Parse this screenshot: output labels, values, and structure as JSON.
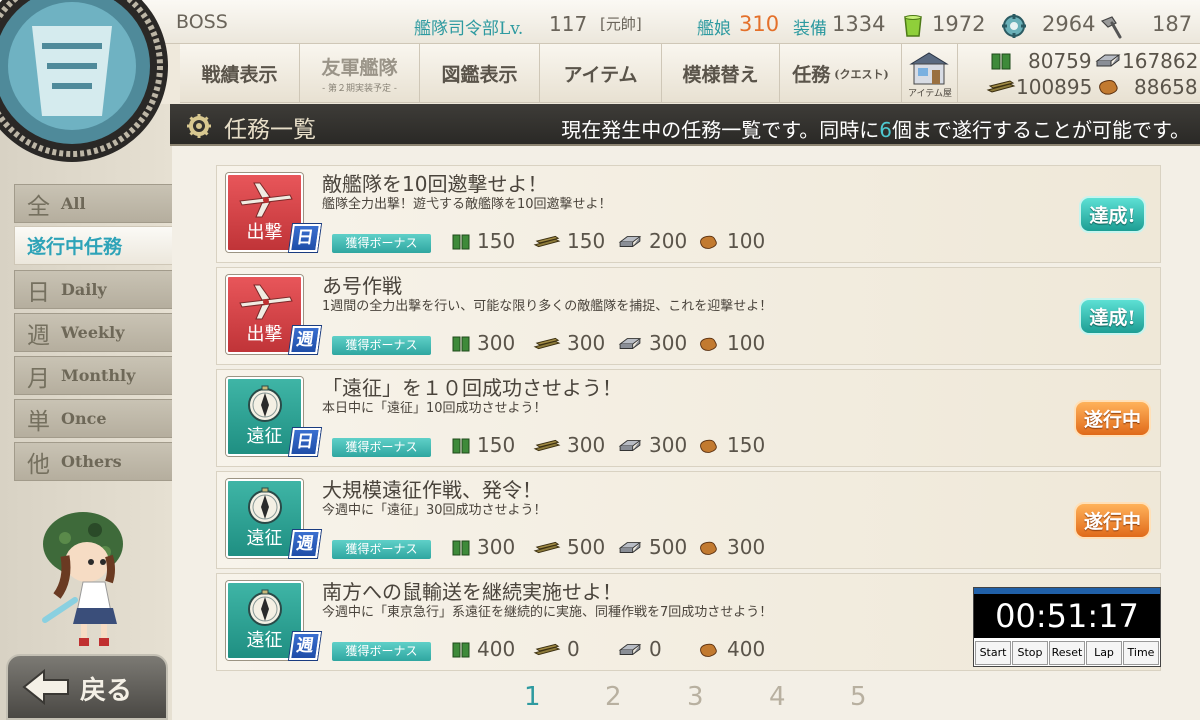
{
  "header": {
    "player_name": "BOSS",
    "hq_label": "艦隊司令部Lv.",
    "hq_level": "117",
    "rank": "[元帥]",
    "ships_label": "艦娘",
    "ships_count": "310",
    "equip_label": "装備",
    "equip_count": "1334",
    "buckets": "1972",
    "dev_materials": "2964",
    "screws": "187"
  },
  "nav": {
    "tabs": [
      {
        "label": "戦績表示"
      },
      {
        "label": "友軍艦隊",
        "sub": "- 第２期実装予定 -"
      },
      {
        "label": "図鑑表示"
      },
      {
        "label": "アイテム"
      },
      {
        "label": "模様替え"
      },
      {
        "label": "任務",
        "small": "(クエスト)"
      }
    ],
    "shop_label": "アイテム屋"
  },
  "resources": {
    "fuel": "80759",
    "steel": "167862",
    "ammo": "100895",
    "bauxite": "88658"
  },
  "title_bar": {
    "title": "任務一覧",
    "info_pre": "現在発生中の任務一覧です。同時に",
    "info_num": "6",
    "info_post": "個まで遂行することが可能です。"
  },
  "sidebar": {
    "tabs": [
      {
        "kanji": "全",
        "en": "All"
      },
      {
        "label": "遂行中任務"
      },
      {
        "kanji": "日",
        "en": "Daily"
      },
      {
        "kanji": "週",
        "en": "Weekly"
      },
      {
        "kanji": "月",
        "en": "Monthly"
      },
      {
        "kanji": "単",
        "en": "Once"
      },
      {
        "kanji": "他",
        "en": "Others"
      }
    ],
    "back_label": "戻る"
  },
  "quests": [
    {
      "category": "出撃",
      "period": "日",
      "title": "敵艦隊を10回邀撃せよ！",
      "desc": "艦隊全力出撃！遊弋する敵艦隊を10回邀撃せよ！",
      "bonus": "獲得ボーナス",
      "fuel": "150",
      "ammo": "150",
      "steel": "200",
      "bauxite": "100",
      "status": "達成!"
    },
    {
      "category": "出撃",
      "period": "週",
      "title": "あ号作戦",
      "desc": "1週間の全力出撃を行い、可能な限り多くの敵艦隊を捕捉、これを迎撃せよ！",
      "bonus": "獲得ボーナス",
      "fuel": "300",
      "ammo": "300",
      "steel": "300",
      "bauxite": "100",
      "status": "達成!"
    },
    {
      "category": "遠征",
      "period": "日",
      "title": "「遠征」を１０回成功させよう！",
      "desc": "本日中に「遠征」10回成功させよう！",
      "bonus": "獲得ボーナス",
      "fuel": "150",
      "ammo": "300",
      "steel": "300",
      "bauxite": "150",
      "status": "遂行中"
    },
    {
      "category": "遠征",
      "period": "週",
      "title": "大規模遠征作戦、発令！",
      "desc": "今週中に「遠征」30回成功させよう！",
      "bonus": "獲得ボーナス",
      "fuel": "300",
      "ammo": "500",
      "steel": "500",
      "bauxite": "300",
      "status": "遂行中"
    },
    {
      "category": "遠征",
      "period": "週",
      "title": "南方への鼠輸送を継続実施せよ！",
      "desc": "今週中に「東京急行」系遠征を継続的に実施、同種作戦を7回成功させよう！",
      "bonus": "獲得ボーナス",
      "fuel": "400",
      "ammo": "0",
      "steel": "0",
      "bauxite": "400",
      "status": ""
    }
  ],
  "pages": [
    "1",
    "2",
    "3",
    "4",
    "5"
  ],
  "stopwatch": {
    "time": "00:51:17",
    "buttons": [
      "Start",
      "Stop",
      "Reset",
      "Lap",
      "Time"
    ]
  },
  "colors": {
    "accent": "#2e9aa0",
    "ship_count": "#e4702a",
    "sortie": "#d44448",
    "expedition": "#2aa596",
    "title_bar": "#2f2d2a"
  }
}
